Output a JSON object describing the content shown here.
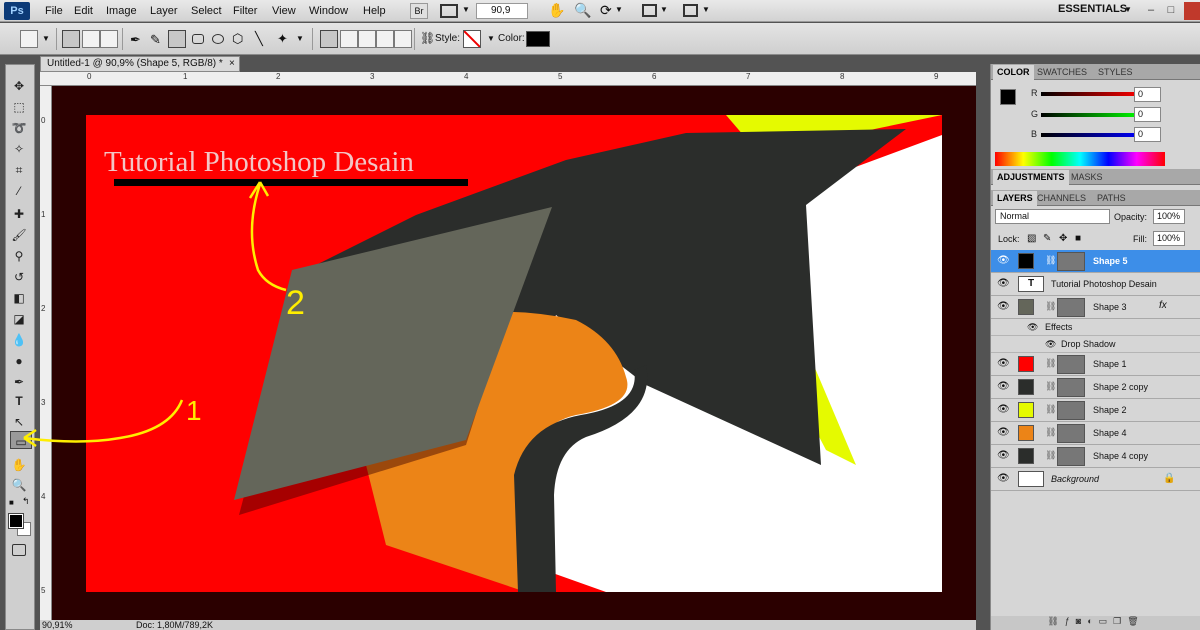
{
  "app": {
    "logo": "Ps"
  },
  "menu": [
    "File",
    "Edit",
    "Image",
    "Layer",
    "Select",
    "Filter",
    "View",
    "Window",
    "Help"
  ],
  "menubar": {
    "bridge_label": "Br",
    "zoom_value": "90,9",
    "workspace": "ESSENTIALS",
    "minimize": "–",
    "restore": "□"
  },
  "options": {
    "style_label": "Style:",
    "color_label": "Color:",
    "color_value": "#000000"
  },
  "document": {
    "tab_title": "Untitled-1 @ 90,9% (Shape 5, RGB/8) *",
    "close": "×",
    "ruler_h_ticks": [
      "0",
      "1",
      "2",
      "3",
      "4",
      "5",
      "6",
      "7",
      "8",
      "9",
      "10"
    ],
    "ruler_v_ticks": [
      "0",
      "1",
      "2",
      "3",
      "4",
      "5"
    ],
    "zoom_status": "90,91%",
    "doc_status": "Doc: 1,80M/789,2K"
  },
  "artwork": {
    "title_text": "Tutorial Photoshop Desain",
    "annotation_1": "1",
    "annotation_2": "2",
    "colors": {
      "canvas_bg": "#2b0000",
      "red": "#ff0000",
      "dark": "#2b2d2b",
      "gray": "#64665a",
      "orange": "#ec8417",
      "yellow": "#e5fa00",
      "white": "#ffffff",
      "annotation": "#ffee00"
    }
  },
  "panels": {
    "color_tabs": [
      "COLOR",
      "SWATCHES",
      "STYLES"
    ],
    "color": {
      "r_label": "R",
      "g_label": "G",
      "b_label": "B",
      "r_value": "0",
      "g_value": "0",
      "b_value": "0"
    },
    "adjust_tabs": [
      "ADJUSTMENTS",
      "MASKS"
    ],
    "layer_tabs": [
      "LAYERS",
      "CHANNELS",
      "PATHS"
    ],
    "layers": {
      "blend_mode": "Normal",
      "opacity_label": "Opacity:",
      "opacity_value": "100%",
      "lock_label": "Lock:",
      "fill_label": "Fill:",
      "fill_value": "100%",
      "rows": [
        {
          "name": "Shape 5",
          "thumb_color": "#000000",
          "selected": true,
          "has_mask": true
        },
        {
          "name": "Tutorial Photoshop Desain",
          "type": "text"
        },
        {
          "name": "Shape 3",
          "thumb_color": "#64665a",
          "has_mask": true,
          "fx": "fx"
        },
        {
          "name": "Shape 1",
          "thumb_color": "#ff0000",
          "has_mask": true
        },
        {
          "name": "Shape 2 copy",
          "thumb_color": "#2b2d2b",
          "has_mask": true
        },
        {
          "name": "Shape 2",
          "thumb_color": "#e5fa00",
          "has_mask": true
        },
        {
          "name": "Shape 4",
          "thumb_color": "#ec8417",
          "has_mask": true
        },
        {
          "name": "Shape 4 copy",
          "thumb_color": "#2b2d2b",
          "has_mask": true
        },
        {
          "name": "Background",
          "thumb_color": "#ffffff",
          "locked": true
        }
      ],
      "effects_label": "Effects",
      "drop_shadow_label": "Drop Shadow",
      "text_thumb": "T"
    }
  }
}
